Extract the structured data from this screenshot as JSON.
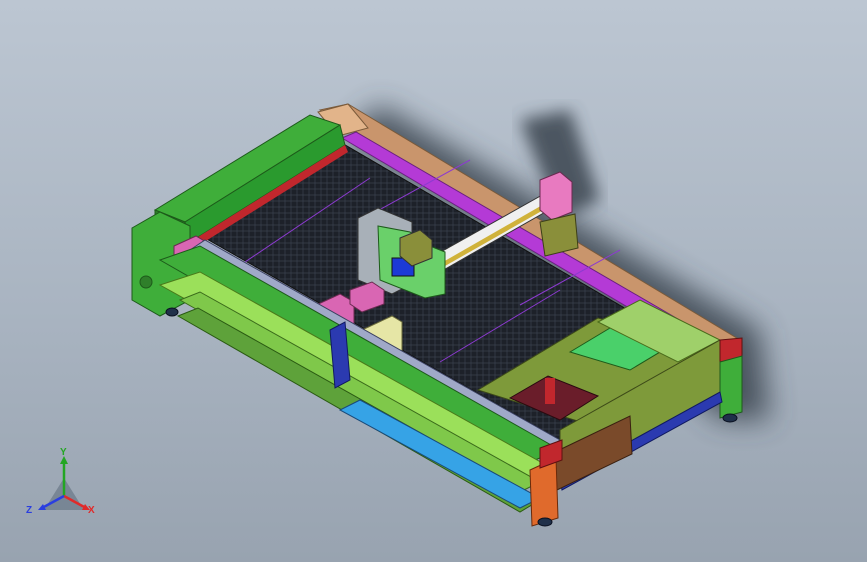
{
  "window": {
    "background_top": "#bcc6d2",
    "background_bottom": "#98a3b0"
  },
  "model": {
    "name": "laser-cutting-machine-assembly",
    "colors": {
      "frame_green": "#3fae3a",
      "frame_dark_green": "#2f7f2a",
      "lime": "#9be05a",
      "bed_black": "#1d2129",
      "purple_rail": "#b43ad6",
      "tan_rail": "#c9956c",
      "red_accent": "#c1272d",
      "magenta": "#d966b3",
      "blue_rail": "#2b3ab0",
      "cyan_tray": "#36a3e6",
      "olive": "#7e9a3a",
      "orange_leg": "#e06a2c",
      "cream_box": "#e6e6a6",
      "shadow": "#555f6c"
    }
  },
  "triad": {
    "x_label": "X",
    "y_label": "Y",
    "z_label": "Z",
    "x_color": "#e02a2a",
    "y_color": "#23a623",
    "z_color": "#2a3ee0"
  }
}
